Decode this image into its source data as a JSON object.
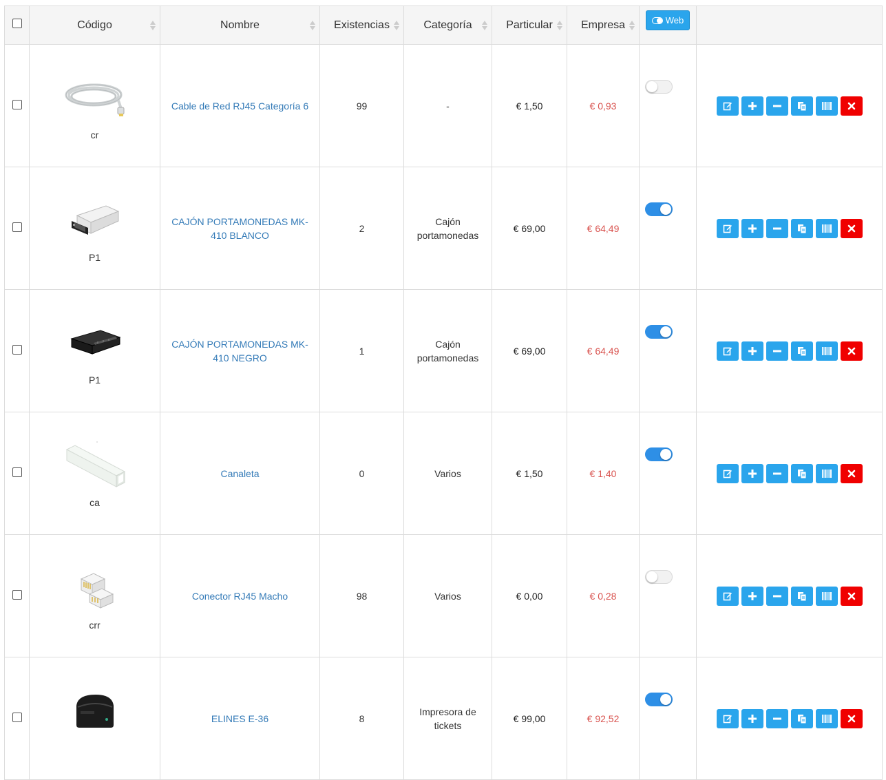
{
  "header": {
    "codigo": "Código",
    "nombre": "Nombre",
    "existencias": "Existencias",
    "categoria": "Categoría",
    "particular": "Particular",
    "empresa": "Empresa",
    "web": "Web"
  },
  "rows": [
    {
      "code": "cr",
      "name": "Cable de Red RJ45 Categoría 6",
      "stock": "99",
      "category": "-",
      "particular": "€ 1,50",
      "empresa": "€ 0,93",
      "web": false,
      "image": "network-cable"
    },
    {
      "code": "P1",
      "name": "CAJÓN PORTAMONEDAS MK-410 BLANCO",
      "stock": "2",
      "category": "Cajón portamonedas",
      "particular": "€ 69,00",
      "empresa": "€ 64,49",
      "web": true,
      "image": "cash-drawer-white"
    },
    {
      "code": "P1",
      "name": "CAJÓN PORTAMONEDAS MK-410 NEGRO",
      "stock": "1",
      "category": "Cajón portamonedas",
      "particular": "€ 69,00",
      "empresa": "€ 64,49",
      "web": true,
      "image": "cash-drawer-black"
    },
    {
      "code": "ca",
      "name": "Canaleta",
      "stock": "0",
      "category": "Varios",
      "particular": "€ 1,50",
      "empresa": "€ 1,40",
      "web": true,
      "image": "cable-duct"
    },
    {
      "code": "crr",
      "name": "Conector RJ45 Macho",
      "stock": "98",
      "category": "Varios",
      "particular": "€ 0,00",
      "empresa": "€ 0,28",
      "web": false,
      "image": "rj45-connector"
    },
    {
      "code": "",
      "name": "ELINES E-36",
      "stock": "8",
      "category": "Impresora de tickets",
      "particular": "€ 99,00",
      "empresa": "€ 92,52",
      "web": true,
      "image": "ticket-printer"
    }
  ],
  "actions": [
    "edit-icon",
    "plus-icon",
    "minus-icon",
    "copy-icon",
    "barcode-icon",
    "delete-icon"
  ],
  "colors": {
    "action": "#2aa5ec",
    "delete": "#f00000",
    "link": "#337ab7",
    "empresa": "#d9534f",
    "toggle_on": "#2e8fe6"
  }
}
